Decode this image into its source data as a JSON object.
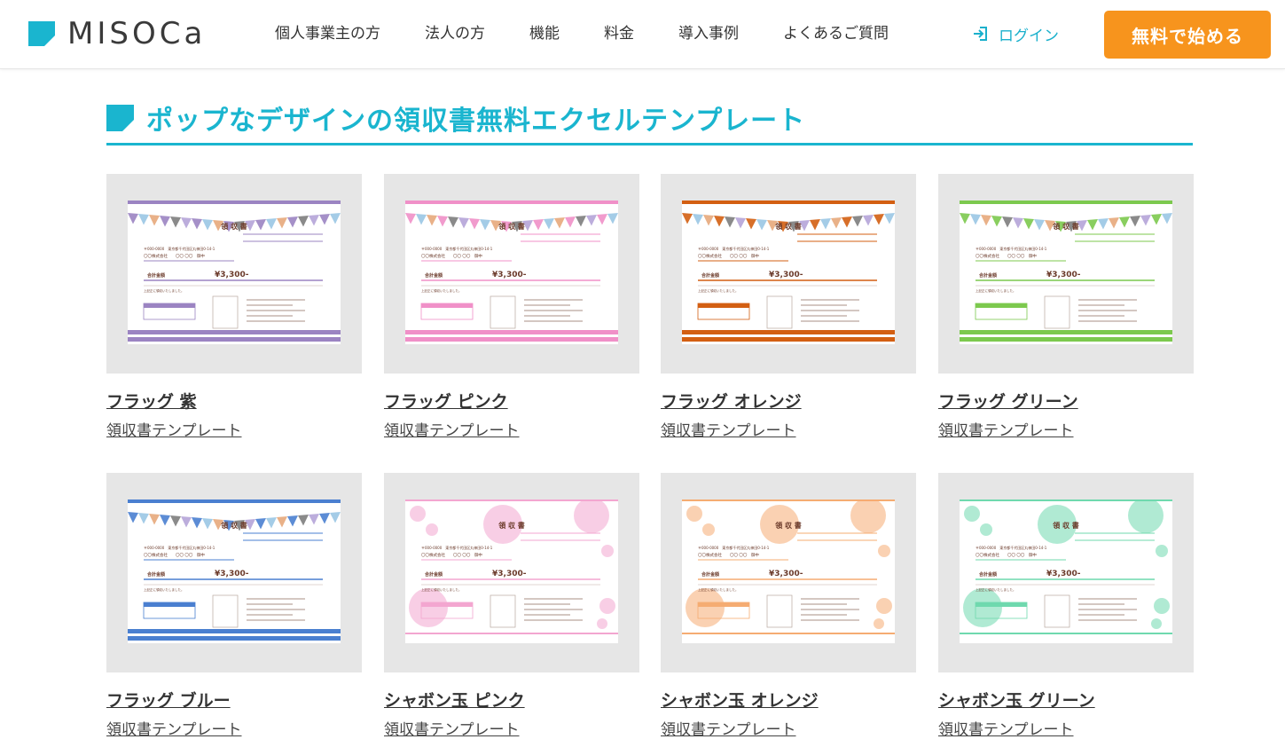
{
  "header": {
    "logo_text": "MISOCa",
    "brand_color": "#1ab5cf",
    "nav": [
      {
        "label": "個人事業主の方",
        "name": "nav-sole-proprietor"
      },
      {
        "label": "法人の方",
        "name": "nav-corporation"
      },
      {
        "label": "機能",
        "name": "nav-features"
      },
      {
        "label": "料金",
        "name": "nav-pricing"
      },
      {
        "label": "導入事例",
        "name": "nav-case-studies"
      },
      {
        "label": "よくあるご質問",
        "name": "nav-faq"
      }
    ],
    "login_label": "ログイン",
    "cta_label": "無料で始める",
    "cta_color": "#f7941d"
  },
  "section": {
    "title": "ポップなデザインの領収書無料エクセルテンプレート"
  },
  "thumbnail_text": {
    "doc_title": "領 収 書",
    "address": "〒000-0000　東京都千代田区丸神田0-14-1",
    "company": "〇〇株式会社　　〇〇 〇〇　御中",
    "total_label": "合計金額",
    "amount": "¥3,300-",
    "note": "上記正に領収いたしました。"
  },
  "templates": [
    {
      "name": "フラッグ 紫",
      "sub": "領収書テンプレート",
      "style": "flag",
      "accent": "#9b84c2"
    },
    {
      "name": "フラッグ ピンク",
      "sub": "領収書テンプレート",
      "style": "flag",
      "accent": "#f090c8"
    },
    {
      "name": "フラッグ オレンジ",
      "sub": "領収書テンプレート",
      "style": "flag",
      "accent": "#d35f12"
    },
    {
      "name": "フラッグ グリーン",
      "sub": "領収書テンプレート",
      "style": "flag",
      "accent": "#7cc94e"
    },
    {
      "name": "フラッグ ブルー",
      "sub": "領収書テンプレート",
      "style": "flag",
      "accent": "#4a7fd0"
    },
    {
      "name": "シャボン玉 ピンク",
      "sub": "領収書テンプレート",
      "style": "bubble",
      "accent": "#f3a6d0"
    },
    {
      "name": "シャボン玉 オレンジ",
      "sub": "領収書テンプレート",
      "style": "bubble",
      "accent": "#f5ac72"
    },
    {
      "name": "シャボン玉 グリーン",
      "sub": "領収書テンプレート",
      "style": "bubble",
      "accent": "#6fd9ae"
    }
  ]
}
